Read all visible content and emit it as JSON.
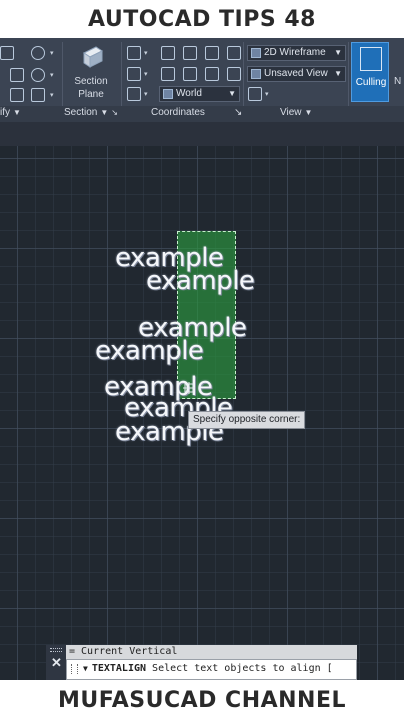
{
  "banner": {
    "top": "AUTOCAD TIPS 48",
    "bottom": "MUFASUCAD CHANNEL"
  },
  "ribbon": {
    "panels": {
      "modify": "ify",
      "section": "Section",
      "coordinates": "Coordinates",
      "view": "View"
    },
    "section_plane": {
      "line1": "Section",
      "line2": "Plane"
    },
    "ucs_dropdown": "World",
    "visual_style": "2D Wireframe",
    "named_view": "Unsaved View",
    "culling_label": "Culling",
    "next_label": "N"
  },
  "drawing": {
    "texts": [
      "example",
      "example",
      "example",
      "example",
      "example",
      "example",
      "example"
    ],
    "tooltip": "Specify opposite corner:"
  },
  "command": {
    "history": "= Current Vertical",
    "name": "TEXTALIGN",
    "prompt": "Select text objects to align ["
  },
  "colors": {
    "ribbon": "#3b4453",
    "canvas": "#212830",
    "selection": "#2ca040",
    "culling_active": "#1f6fb8"
  }
}
